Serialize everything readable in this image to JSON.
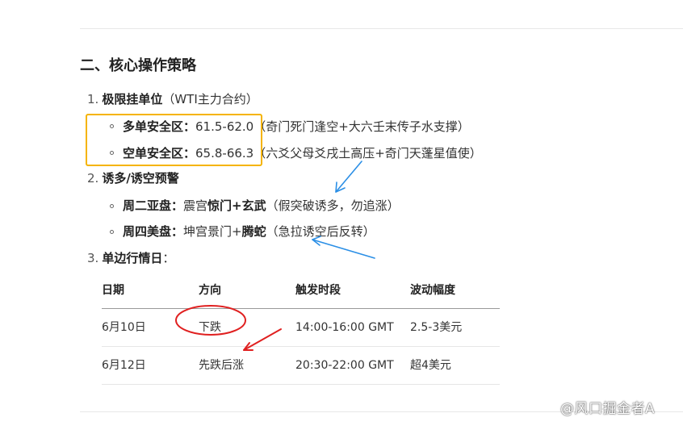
{
  "heading": "二、核心操作策略",
  "items": [
    {
      "num": "1.",
      "title": "极限挂单位",
      "note": "（WTI主力合约）",
      "subs": [
        {
          "label": "多单安全区：",
          "value": "61.5-62.0",
          "note": "（奇门死门逢空+大六壬末传子水支撑）"
        },
        {
          "label": "空单安全区：",
          "value": "65.8-66.3",
          "note": "（六爻父母爻戌土高压+奇门天蓬星值使）"
        }
      ]
    },
    {
      "num": "2.",
      "title": "诱多/诱空预警",
      "note": "",
      "subs": [
        {
          "label": "周二亚盘：",
          "mid": "震宫",
          "bold2": "惊门+玄武",
          "note": "（假突破诱多，勿追涨）"
        },
        {
          "label": "周四美盘：",
          "mid": "坤宫景门+",
          "bold2": "腾蛇",
          "note": "（急拉诱空后反转）"
        }
      ]
    },
    {
      "num": "3.",
      "title": "单边行情日",
      "note": "：",
      "subs": []
    }
  ],
  "table": {
    "headers": [
      "日期",
      "方向",
      "触发时段",
      "波动幅度"
    ],
    "rows": [
      [
        "6月10日",
        "下跌",
        "14:00-16:00 GMT",
        "2.5-3美元"
      ],
      [
        "6月12日",
        "先跌后涨",
        "20:30-22:00 GMT",
        "超4美元"
      ]
    ]
  },
  "watermark": "@风口掘金者A",
  "colors": {
    "highlight_box": "#f5b400",
    "blue_arrow": "#2b8fe6",
    "red_mark": "#e02020"
  }
}
